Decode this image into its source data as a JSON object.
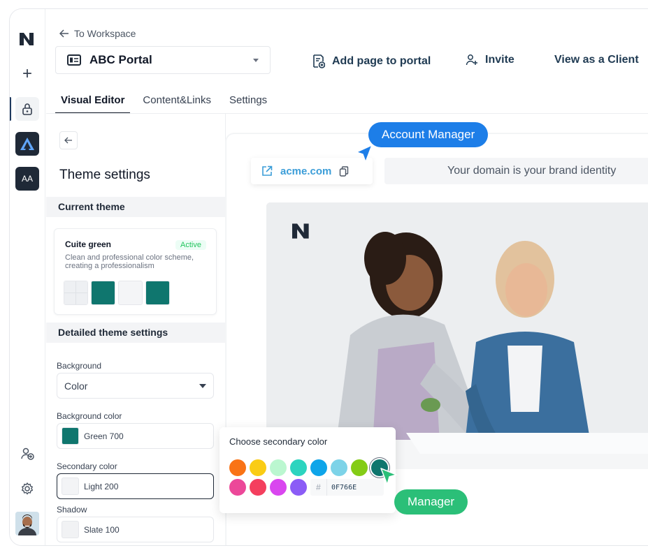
{
  "nav": {
    "back_label": "To Workspace",
    "workspace_abbr": "AA"
  },
  "header": {
    "portal_name": "ABC Portal",
    "actions": {
      "add_page": "Add page to portal",
      "invite": "Invite",
      "view_client": "View as a Client"
    }
  },
  "tabs": [
    "Visual Editor",
    "Content&Links",
    "Settings"
  ],
  "panel": {
    "title": "Theme settings",
    "current_theme_heading": "Current theme",
    "theme": {
      "name": "Cuite green",
      "badge": "Active",
      "description": "Clean and professional color scheme, creating a professionalism",
      "swatches": [
        "#eef0f3",
        "#0f766e",
        "#f4f5f7",
        "#0f766e"
      ]
    },
    "detailed_heading": "Detailed theme settings",
    "background": {
      "label": "Background",
      "value": "Color"
    },
    "background_color": {
      "label": "Background color",
      "value": "Green 700",
      "color": "#0f766e"
    },
    "secondary_color": {
      "label": "Secondary color",
      "value": "Light 200",
      "color": "#f3f4f6"
    },
    "shadow": {
      "label": "Shadow",
      "value": "Slate 100",
      "color": "#f1f2f4"
    }
  },
  "preview": {
    "domain": "acme.com",
    "brand_tagline": "Your domain is your brand identity",
    "tag_account": "Account Manager",
    "tag_manager": "Manager"
  },
  "color_picker": {
    "title": "Choose secondary color",
    "row1": [
      "#f97316",
      "#facc15",
      "#bbf7d0",
      "#2dd4bf",
      "#0ea5e9",
      "#7dd3e8",
      "#84cc16",
      "#0f766e"
    ],
    "row2": [
      "#ec4899",
      "#f43f5e",
      "#d946ef",
      "#8b5cf6"
    ],
    "hex_prefix": "#",
    "hex_value": "0F766E"
  }
}
